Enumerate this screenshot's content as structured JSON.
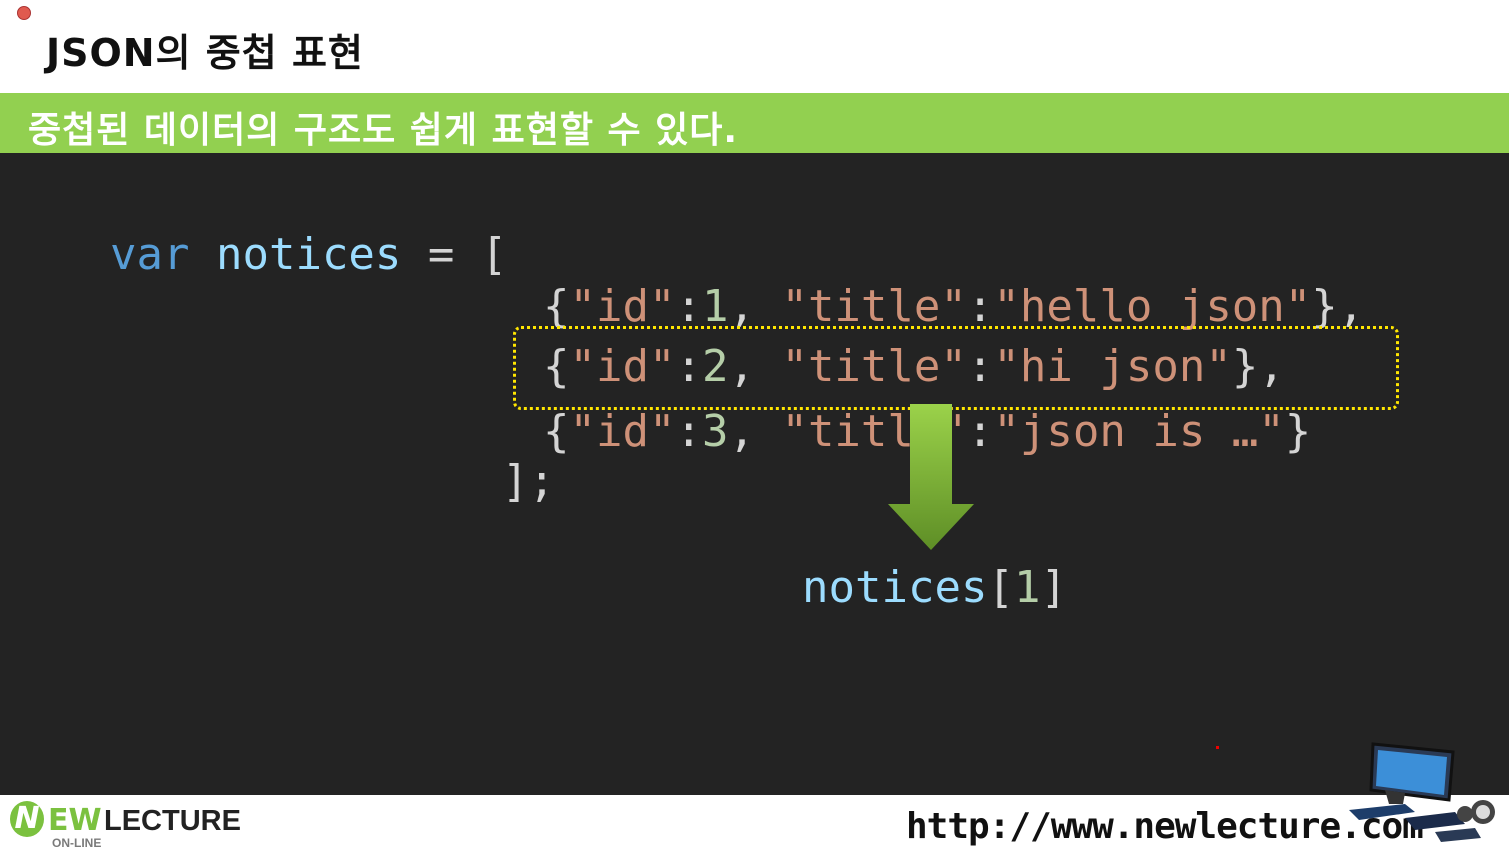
{
  "slide": {
    "title": "JSON의 중첩 표현",
    "subtitle": "중첩된 데이터의 구조도 쉽게 표현할 수 있다."
  },
  "code": {
    "line1": {
      "kw": "var",
      "name": "notices",
      "assign": "=",
      "open": "["
    },
    "rows": [
      {
        "open": "{",
        "k1": "\"id\"",
        "c1": ":",
        "v1": "1",
        "sep": ", ",
        "k2": "\"title\"",
        "c2": ":",
        "v2": "\"hello json\"",
        "close": "},"
      },
      {
        "open": "{",
        "k1": "\"id\"",
        "c1": ":",
        "v1": "2",
        "sep": ", ",
        "k2": "\"title\"",
        "c2": ":",
        "v2": "\"hi json\"",
        "close": "},"
      },
      {
        "open": "{",
        "k1": "\"id\"",
        "c1": ":",
        "v1": "3",
        "sep": ", ",
        "k2": "\"title\"",
        "c2": ":",
        "v2": "\"json is …\"",
        "close": "}"
      }
    ],
    "closing": "];"
  },
  "result": {
    "name": "notices",
    "open": "[",
    "index": "1",
    "close": "]"
  },
  "footer": {
    "logo_n": "N",
    "logo_ew": "EW",
    "logo_lecture": "LECTURE",
    "logo_online": "ON-LINE",
    "url": "http://www.newlecture.com"
  },
  "colors": {
    "banner": "#92d050",
    "code_bg": "#232323",
    "highlight_box": "#ffe600",
    "arrow": "#7aa832"
  }
}
